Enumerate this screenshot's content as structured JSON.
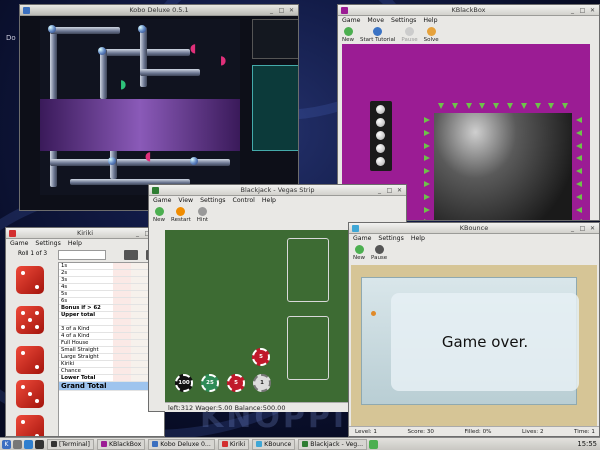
{
  "desktop": {
    "watermark": "KNOPPIX",
    "corner_text": "Do"
  },
  "kobo": {
    "title": "Kobo Deluxe 0.5.1"
  },
  "kblackbox": {
    "title": "KBlackBox",
    "menu": [
      "Game",
      "Move",
      "Settings",
      "Help"
    ],
    "toolbar": [
      "New",
      "Start Tutorial",
      "Pause",
      "Solve"
    ]
  },
  "blackjack": {
    "title": "Blackjack - Vegas Strip",
    "menu": [
      "Game",
      "View",
      "Settings",
      "Control",
      "Help"
    ],
    "toolbar": [
      "New",
      "Restart",
      "Hint"
    ],
    "chips": [
      {
        "value": "100",
        "color": "#111111"
      },
      {
        "value": "25",
        "color": "#2e8b57"
      },
      {
        "value": "5",
        "color": "#c0182a"
      },
      {
        "value": "1",
        "color": "#dcdcdc"
      }
    ],
    "bet_chip": "5",
    "status": "left:312  Wager:5.00  Balance:500.00"
  },
  "kiriki": {
    "title": "Kiriki",
    "menu": [
      "Game",
      "Settings",
      "Help"
    ],
    "roll": "Roll 1 of 3",
    "rows": [
      {
        "label": "1s",
        "bold": false
      },
      {
        "label": "2s",
        "bold": false
      },
      {
        "label": "3s",
        "bold": false
      },
      {
        "label": "4s",
        "bold": false
      },
      {
        "label": "5s",
        "bold": false
      },
      {
        "label": "6s",
        "bold": false
      },
      {
        "label": "Bonus if > 62",
        "bold": true
      },
      {
        "label": "Upper total",
        "bold": true
      },
      {
        "label": "",
        "bold": false
      },
      {
        "label": "3 of a Kind",
        "bold": false
      },
      {
        "label": "4 of a Kind",
        "bold": false
      },
      {
        "label": "Full House",
        "bold": false
      },
      {
        "label": "Small Straight",
        "bold": false
      },
      {
        "label": "Large Straight",
        "bold": false
      },
      {
        "label": "Kiriki",
        "bold": false
      },
      {
        "label": "Chance",
        "bold": false
      },
      {
        "label": "Lower Total",
        "bold": true
      }
    ],
    "grand_total": "Grand Total"
  },
  "kbounce": {
    "title": "KBounce",
    "menu": [
      "Game",
      "Settings",
      "Help"
    ],
    "toolbar": [
      "New",
      "Pause"
    ],
    "overlay": "Game over.",
    "status": {
      "level": "Level: 1",
      "score": "Score: 30",
      "filled": "Filled: 0%",
      "lives": "Lives: 2",
      "time": "Time: 1"
    }
  },
  "taskbar": {
    "tasks": [
      "[Terminal]",
      "KBlackBox",
      "Kobo Deluxe 0...",
      "Kiriki",
      "KBounce",
      "Blackjack - Veg..."
    ],
    "clock": "15:55"
  }
}
